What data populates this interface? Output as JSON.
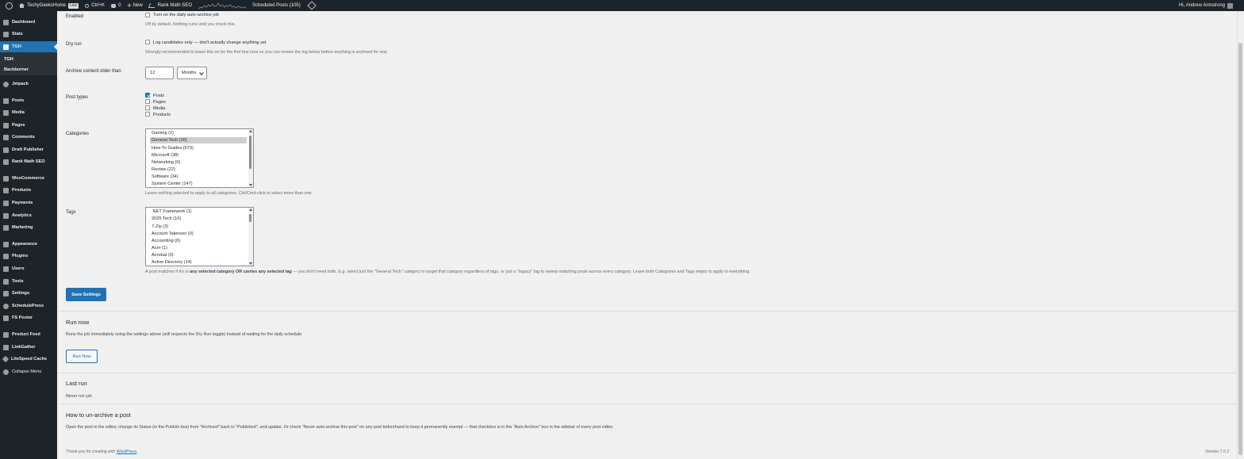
{
  "adminbar": {
    "site_name": "TechyGeeksHome",
    "live_badge": "Live",
    "search_shortcut": "Ctrl+K",
    "comments_count": "0",
    "new_label": "New",
    "rankmath_label": "Rank Math SEO",
    "scheduled_posts": "Scheduled Posts (105)",
    "greeting": "Hi, Andrew Armstrong"
  },
  "sidebar": {
    "items": [
      {
        "label": "Dashboard",
        "icon": "dashboard-icon"
      },
      {
        "label": "Stats",
        "icon": "stats-icon"
      },
      {
        "label": "TGH",
        "icon": "tgh-icon"
      },
      {
        "label": "Jetpack",
        "icon": "jetpack-icon"
      },
      {
        "label": "Posts",
        "icon": "pin-icon"
      },
      {
        "label": "Media",
        "icon": "media-icon"
      },
      {
        "label": "Pages",
        "icon": "pages-icon"
      },
      {
        "label": "Comments",
        "icon": "comments-icon"
      },
      {
        "label": "Draft Publisher",
        "icon": "draft-icon"
      },
      {
        "label": "Rank Math SEO",
        "icon": "rankmath-icon"
      },
      {
        "label": "WooCommerce",
        "icon": "woo-icon"
      },
      {
        "label": "Products",
        "icon": "products-icon"
      },
      {
        "label": "Payments",
        "icon": "payments-icon"
      },
      {
        "label": "Analytics",
        "icon": "analytics-icon"
      },
      {
        "label": "Marketing",
        "icon": "marketing-icon"
      },
      {
        "label": "Appearance",
        "icon": "appearance-icon"
      },
      {
        "label": "Plugins",
        "icon": "plugins-icon"
      },
      {
        "label": "Users",
        "icon": "users-icon"
      },
      {
        "label": "Tools",
        "icon": "tools-icon"
      },
      {
        "label": "Settings",
        "icon": "settings-icon"
      },
      {
        "label": "SchedulePress",
        "icon": "schedulepress-icon"
      },
      {
        "label": "FS Poster",
        "icon": "fsposter-icon"
      },
      {
        "label": "Product Feed",
        "icon": "feed-icon"
      },
      {
        "label": "LinkGather",
        "icon": "link-icon"
      },
      {
        "label": "LiteSpeed Cache",
        "icon": "litespeed-icon"
      },
      {
        "label": "Collapse Menu",
        "icon": "collapse-icon"
      }
    ],
    "submenu": [
      "TGH",
      "Backburner"
    ]
  },
  "form": {
    "enabled_label": "Enabled",
    "enabled_checkbox": "Turn on the daily auto-archive job",
    "enabled_desc": "Off by default. Nothing runs until you check this.",
    "dryrun_label": "Dry run",
    "dryrun_checkbox": "Log candidates only — don't actually change anything yet",
    "dryrun_desc": "Strongly recommended to leave this on for the first few runs so you can review the log below before anything is archived for real.",
    "archive_label": "Archive content older than",
    "archive_value": "12",
    "archive_unit": "Months",
    "post_types_label": "Post types",
    "post_types": [
      {
        "label": "Posts",
        "checked": true
      },
      {
        "label": "Pages",
        "checked": false
      },
      {
        "label": "Media",
        "checked": false
      },
      {
        "label": "Products",
        "checked": false
      }
    ],
    "categories_label": "Categories",
    "categories": [
      "Gaming (2)",
      "General Tech (16)",
      "How-To Guides (573)",
      "Microsoft (38)",
      "Networking (0)",
      "Review (22)",
      "Software (34)",
      "System Center (147)"
    ],
    "categories_selected": "General Tech (16)",
    "categories_desc": "Leave nothing selected to apply to all categories. Ctrl/Cmd-click to select more than one.",
    "tags_label": "Tags",
    "tags": [
      ".NET Framework (1)",
      "2025 Tech (10)",
      "7-Zip (3)",
      "Account Takeover (0)",
      "Accounting (0)",
      "Acer (1)",
      "Acrobat (0)",
      "Active Directory (14)"
    ],
    "tags_desc_pre": "A post matches if it's in ",
    "tags_desc_bold": "any selected category OR carries any selected tag",
    "tags_desc_post": " — you don't need both. E.g. select just the \"General Tech\" category to target that category regardless of tags, or just a \"legacy\" tag to sweep matching posts across every category. Leave both Categories and Tags empty to apply to everything.",
    "save_button": "Save Settings"
  },
  "run_now": {
    "heading": "Run now",
    "desc": "Runs the job immediately using the settings above (still respects the Dry Run toggle) instead of waiting for the daily schedule.",
    "button": "Run Now"
  },
  "last_run": {
    "heading": "Last run",
    "text": "Never run yet."
  },
  "unarchive": {
    "heading": "How to un-archive a post",
    "text": "Open the post in the editor, change its Status (in the Publish box) from \"Archived\" back to \"Published\", and update. Or check \"Never auto-archive this post\" on any post beforehand to keep it permanently exempt — that checkbox is in the \"Auto Archive\" box in the sidebar of every post editor."
  },
  "footer": {
    "thanks_pre": "Thank you for creating with ",
    "thanks_link": "WordPress",
    "version": "Version 7.0.2"
  },
  "colors": {
    "admin_bg": "#1d2327",
    "accent": "#2271b1",
    "page_bg": "#f0f0f1"
  }
}
